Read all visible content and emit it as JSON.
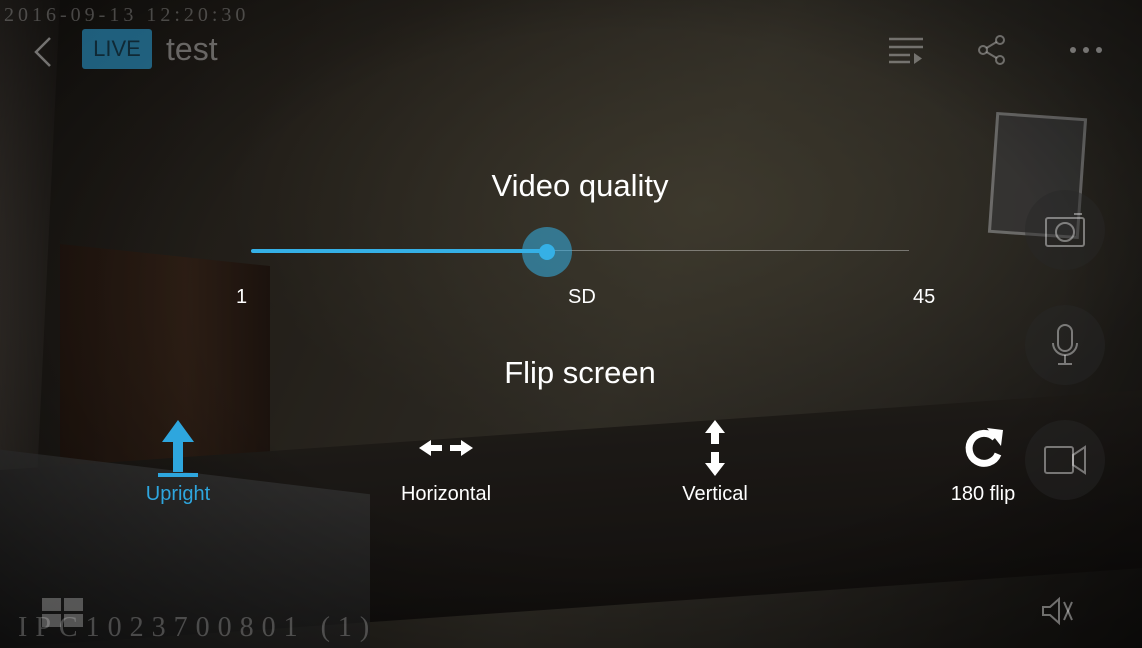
{
  "osd": {
    "timestamp": "2016-09-13 12:20:30",
    "device_id": "IPC1023700801 (1)"
  },
  "header": {
    "live_badge": "LIVE",
    "title": "test",
    "icons": [
      "back-arrow-icon",
      "playlist-icon",
      "share-icon",
      "more-icon"
    ]
  },
  "video_quality": {
    "title": "Video quality",
    "min_label": "1",
    "current_label": "SD",
    "max_label": "45",
    "value_fraction": 0.45,
    "accent_color": "#35b0e6"
  },
  "flip_screen": {
    "title": "Flip screen",
    "options": [
      {
        "label": "Upright",
        "icon": "arrow-up-icon",
        "selected": true
      },
      {
        "label": "Horizontal",
        "icon": "arrows-horizontal-icon",
        "selected": false
      },
      {
        "label": "Vertical",
        "icon": "arrows-vertical-icon",
        "selected": false
      },
      {
        "label": "180 flip",
        "icon": "rotate-icon",
        "selected": false
      }
    ],
    "selected_color": "#2ea6de"
  },
  "side_controls": [
    "camera-icon",
    "microphone-icon",
    "video-camera-icon"
  ],
  "footer_icons": [
    "grid-view-icon",
    "mute-icon"
  ]
}
